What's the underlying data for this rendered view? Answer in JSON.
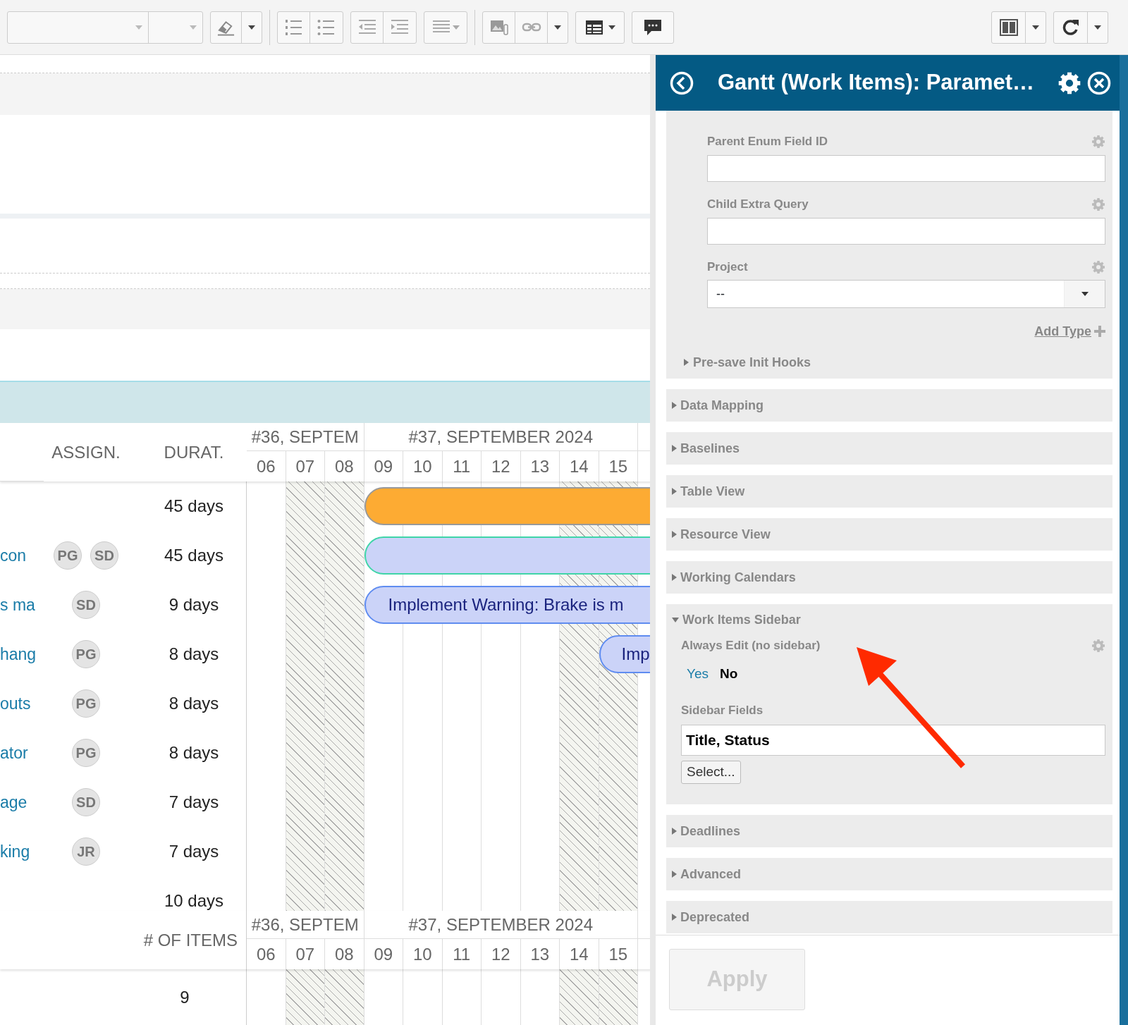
{
  "gantt": {
    "columns": [
      {
        "label": "ASSIGN."
      },
      {
        "label": "DURAT."
      }
    ],
    "weeks": [
      {
        "label": "#36, SEPTEM",
        "days": [
          {
            "label": "06",
            "weekend": false
          },
          {
            "label": "07",
            "weekend": true
          },
          {
            "label": "08",
            "weekend": true
          }
        ]
      },
      {
        "label": "#37, SEPTEMBER 2024",
        "days": [
          {
            "label": "09",
            "weekend": false
          },
          {
            "label": "10",
            "weekend": false
          },
          {
            "label": "11",
            "weekend": false
          },
          {
            "label": "12",
            "weekend": false
          },
          {
            "label": "13",
            "weekend": false
          },
          {
            "label": "14",
            "weekend": true
          },
          {
            "label": "15",
            "weekend": true
          }
        ]
      }
    ],
    "rows": [
      {
        "duration": "45 days",
        "bar": {
          "kind": "summary"
        }
      },
      {
        "name": "con",
        "assignees": [
          "PG",
          "SD"
        ],
        "duration": "45 days",
        "bar": {
          "kind": "parent"
        }
      },
      {
        "name": "s ma",
        "assignees": [
          "SD"
        ],
        "duration": "9 days",
        "bar": {
          "kind": "task",
          "label": "Implement Warning: Brake is m"
        }
      },
      {
        "name": "hang",
        "assignees": [
          "PG"
        ],
        "duration": "8 days",
        "bar": {
          "kind": "task",
          "label": "Imp"
        }
      },
      {
        "name": "outs",
        "assignees": [
          "PG"
        ],
        "duration": "8 days"
      },
      {
        "name": "ator",
        "assignees": [
          "PG"
        ],
        "duration": "8 days"
      },
      {
        "name": "age",
        "assignees": [
          "SD"
        ],
        "duration": "7 days"
      },
      {
        "name": "king",
        "assignees": [
          "JR"
        ],
        "duration": "7 days"
      },
      {
        "duration": "10 days"
      }
    ],
    "footer": {
      "label": "# OF ITEMS",
      "value": "9",
      "weeks": [
        {
          "label": "#36, SEPTEM",
          "days": [
            {
              "label": "06",
              "weekend": false
            },
            {
              "label": "07",
              "weekend": true
            },
            {
              "label": "08",
              "weekend": true
            }
          ]
        },
        {
          "label": "#37, SEPTEMBER 2024",
          "days": [
            {
              "label": "09",
              "weekend": false
            },
            {
              "label": "10",
              "weekend": false
            },
            {
              "label": "11",
              "weekend": false
            },
            {
              "label": "12",
              "weekend": false
            },
            {
              "label": "13",
              "weekend": false
            },
            {
              "label": "14",
              "weekend": true
            },
            {
              "label": "15",
              "weekend": true
            }
          ]
        }
      ]
    }
  },
  "panel": {
    "title": "Gantt (Work Items): Paramet…",
    "fields": [
      {
        "kind": "text",
        "label": "Parent Enum Field ID"
      },
      {
        "kind": "text",
        "label": "Child Extra Query"
      },
      {
        "kind": "select",
        "label": "Project",
        "value": "--"
      }
    ],
    "add_link": "Add Type",
    "subsection": {
      "label": "Pre-save Init Hooks",
      "expanded": false
    },
    "sections": [
      {
        "label": "Data Mapping",
        "expanded": false
      },
      {
        "label": "Baselines",
        "expanded": false
      },
      {
        "label": "Table View",
        "expanded": false
      },
      {
        "label": "Resource View",
        "expanded": false
      },
      {
        "label": "Working Calendars",
        "expanded": false
      },
      {
        "label": "Work Items Sidebar",
        "expanded": true,
        "fields": [
          {
            "kind": "toggle",
            "label": "Always Edit (no sidebar)",
            "options": [
              {
                "label": "Yes",
                "selected": false
              },
              {
                "label": "No",
                "selected": true
              }
            ]
          },
          {
            "kind": "multi",
            "label": "Sidebar Fields",
            "value": "Title, Status",
            "button": "Select..."
          }
        ]
      },
      {
        "label": "Deadlines",
        "expanded": false
      },
      {
        "label": "Advanced",
        "expanded": false
      },
      {
        "label": "Deprecated",
        "expanded": false
      }
    ],
    "apply": {
      "label": "Apply",
      "disabled": true
    }
  }
}
